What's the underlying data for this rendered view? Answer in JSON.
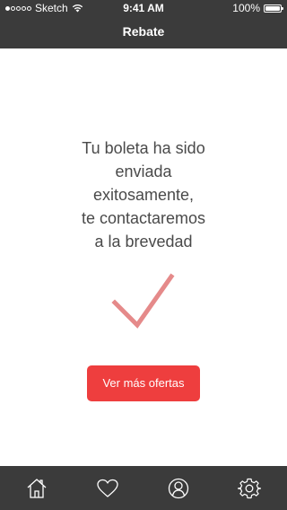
{
  "status_bar": {
    "carrier": "Sketch",
    "time": "9:41 AM",
    "battery": "100%",
    "signal_bars_filled": 1,
    "signal_bars_total": 5
  },
  "nav": {
    "title": "Rebate"
  },
  "confirmation": {
    "lines": [
      "Tu boleta ha sido",
      "enviada",
      "exitosamente,",
      "te contactaremos",
      "a la brevedad"
    ],
    "icon": "check-icon",
    "icon_color": "#e58a8a"
  },
  "cta": {
    "label": "Ver más ofertas",
    "color": "#ee3e3e"
  },
  "tab_bar": {
    "items": [
      {
        "icon": "home-icon"
      },
      {
        "icon": "heart-icon"
      },
      {
        "icon": "profile-icon"
      },
      {
        "icon": "settings-icon"
      }
    ],
    "background": "#3b3b3b"
  }
}
